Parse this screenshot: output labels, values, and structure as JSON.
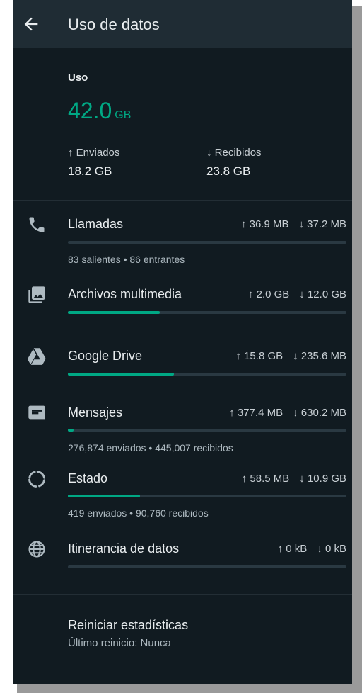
{
  "header": {
    "title": "Uso de datos"
  },
  "usage": {
    "label": "Uso",
    "total_value": "42.0",
    "total_unit": "GB",
    "sent_label": "↑ Enviados",
    "sent_value": "18.2 GB",
    "received_label": "↓ Recibidos",
    "received_value": "23.8 GB"
  },
  "rows": [
    {
      "title": "Llamadas",
      "up": "↑ 36.9 MB",
      "down": "↓ 37.2 MB",
      "fill_fraction": 0.0,
      "subtitle": "83 salientes • 86 entrantes",
      "icon": "phone-icon"
    },
    {
      "title": "Archivos multimedia",
      "up": "↑ 2.0 GB",
      "down": "↓ 12.0 GB",
      "fill_fraction": 0.33,
      "subtitle": "",
      "icon": "media-icon"
    },
    {
      "title": "Google Drive",
      "up": "↑ 15.8 GB",
      "down": "↓ 235.6 MB",
      "fill_fraction": 0.38,
      "subtitle": "",
      "icon": "google-drive-icon"
    },
    {
      "title": "Mensajes",
      "up": "↑ 377.4 MB",
      "down": "↓ 630.2 MB",
      "fill_fraction": 0.02,
      "subtitle": "276,874 enviados • 445,007 recibidos",
      "icon": "message-icon"
    },
    {
      "title": "Estado",
      "up": "↑ 58.5 MB",
      "down": "↓ 10.9 GB",
      "fill_fraction": 0.26,
      "subtitle": "419 enviados • 90,760 recibidos",
      "icon": "status-icon"
    },
    {
      "title": "Itinerancia de datos",
      "up": "↑ 0 kB",
      "down": "↓ 0 kB",
      "fill_fraction": 0.0,
      "subtitle": "",
      "icon": "globe-icon"
    }
  ],
  "reset": {
    "title": "Reiniciar estadísticas",
    "subtitle": "Último reinicio: Nunca"
  },
  "colors": {
    "accent": "#00a884",
    "background": "#111b21",
    "appbar": "#1f2c34"
  }
}
